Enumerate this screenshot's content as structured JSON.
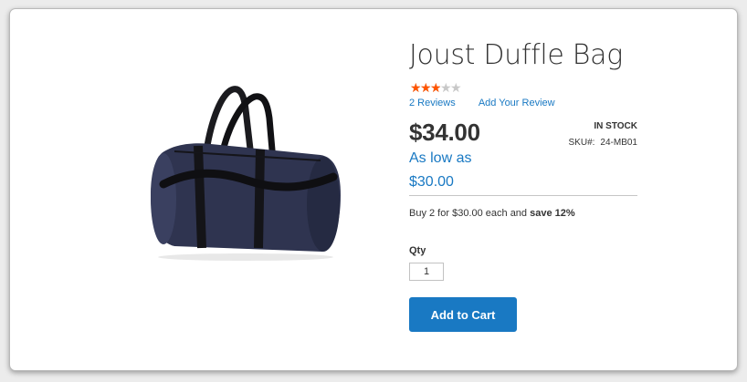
{
  "product": {
    "name": "Joust Duffle Bag",
    "image_alt": "duffle-bag-image",
    "rating": {
      "fraction": 0.6,
      "max": 5,
      "star_glyph": "★",
      "filled_color": "#ff5501",
      "empty_color": "#c8c8c8"
    },
    "reviews_link": "2 Reviews",
    "add_review_link": "Add Your Review",
    "price": "$34.00",
    "as_low_as_label": "As low as",
    "as_low_as_price": "$30.00",
    "stock": "IN STOCK",
    "sku_label": "SKU#:",
    "sku_value": "24-MB01",
    "tier": {
      "prefix": "Buy 2 for $30.00 each and ",
      "bold": "save 12%"
    },
    "qty_label": "Qty",
    "qty_value": "1",
    "add_to_cart_label": "Add to Cart"
  },
  "colors": {
    "accent": "#1979c3",
    "text": "#333333"
  }
}
